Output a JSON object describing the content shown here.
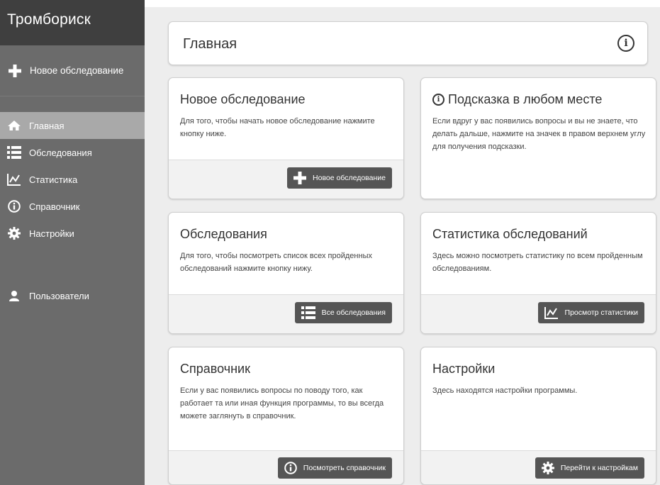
{
  "sidebar": {
    "brand": "Тромбориск",
    "new_exam_label": "Новое обследование",
    "items": [
      {
        "label": "Главная",
        "icon": "home-icon",
        "active": true
      },
      {
        "label": "Обследования",
        "icon": "list-icon"
      },
      {
        "label": "Статистика",
        "icon": "chart-icon"
      },
      {
        "label": "Справочник",
        "icon": "info-icon"
      },
      {
        "label": "Настройки",
        "icon": "gear-icon"
      }
    ],
    "users_label": "Пользователи"
  },
  "header": {
    "title": "Главная",
    "info_icon": "info-icon"
  },
  "cards": {
    "new_exam": {
      "title": "Новое обследование",
      "text": "Для того, чтобы начать новое обследование нажмите кнопку ниже.",
      "button": "Новое обследование"
    },
    "hint": {
      "title": "Подсказка в любом месте",
      "text": "Если вдруг у вас появились вопросы и вы не знаете, что делать дальше, нажмите на значек в правом верхнем углу для получения подсказки."
    },
    "exams": {
      "title": "Обследования",
      "text": "Для того, чтобы посмотреть список всех пройденных обследований нажмите кнопку нижу.",
      "button": "Все обследования"
    },
    "stats": {
      "title": "Статистика обследований",
      "text": "Здесь можно посмотреть статистику по всем пройденным обследованиям.",
      "button": "Просмотр статистики"
    },
    "reference": {
      "title": "Справочник",
      "text": "Если у вас появились вопросы по поводу того, как работает та или иная функция программы, то вы всегда можете заглянуть в справочник.",
      "button": "Посмотреть справочник"
    },
    "settings": {
      "title": "Настройки",
      "text": "Здесь находятся настройки программы.",
      "button": "Перейти к настройкам"
    }
  },
  "colors": {
    "sidebar_bg": "#6b6b6b",
    "brand_bg": "#3f3f3f",
    "active_item_bg": "#a9a9a9",
    "main_bg": "#ededed",
    "button_bg": "#555555"
  }
}
